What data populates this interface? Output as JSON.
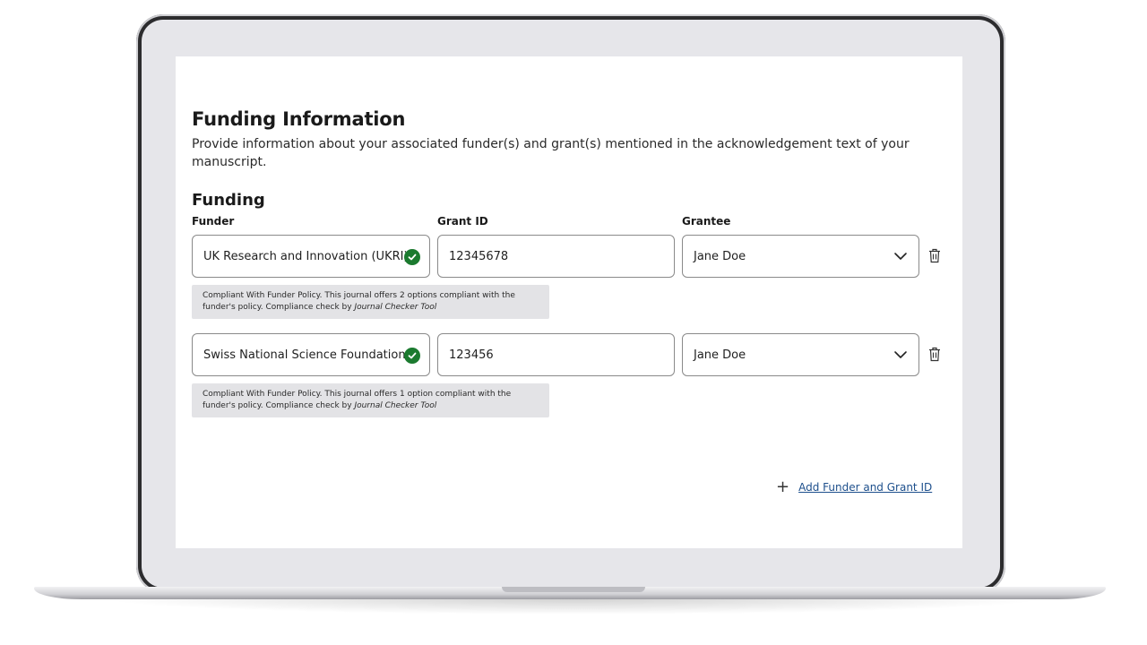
{
  "page": {
    "title": "Funding Information",
    "description": "Provide information about your associated funder(s) and grant(s) mentioned in the acknowledgement text of your manuscript."
  },
  "funding": {
    "section_title": "Funding",
    "columns": {
      "funder": "Funder",
      "grant_id": "Grant ID",
      "grantee": "Grantee"
    },
    "rows": [
      {
        "funder": "UK Research and Innovation (UKRI)",
        "grant_id": "12345678",
        "grantee": "Jane Doe",
        "note_text": "Compliant With Funder Policy. This journal offers 2 options compliant with the funder's policy. Compliance check by ",
        "note_tool": "Journal Checker Tool"
      },
      {
        "funder": "Swiss National Science Foundation",
        "grant_id": "123456",
        "grantee": "Jane Doe",
        "note_text": "Compliant With Funder Policy. This journal offers 1 option compliant with the funder's policy. Compliance check by ",
        "note_tool": "Journal Checker Tool"
      }
    ],
    "add_label": "Add Funder and Grant ID"
  },
  "icons": {
    "check": "check-circle-icon",
    "chevron": "chevron-down-icon",
    "trash": "trash-icon",
    "plus": "plus-icon"
  },
  "colors": {
    "check_green": "#1b7a2f",
    "link_blue": "#1d4f8c",
    "note_bg": "#e3e3e6"
  }
}
